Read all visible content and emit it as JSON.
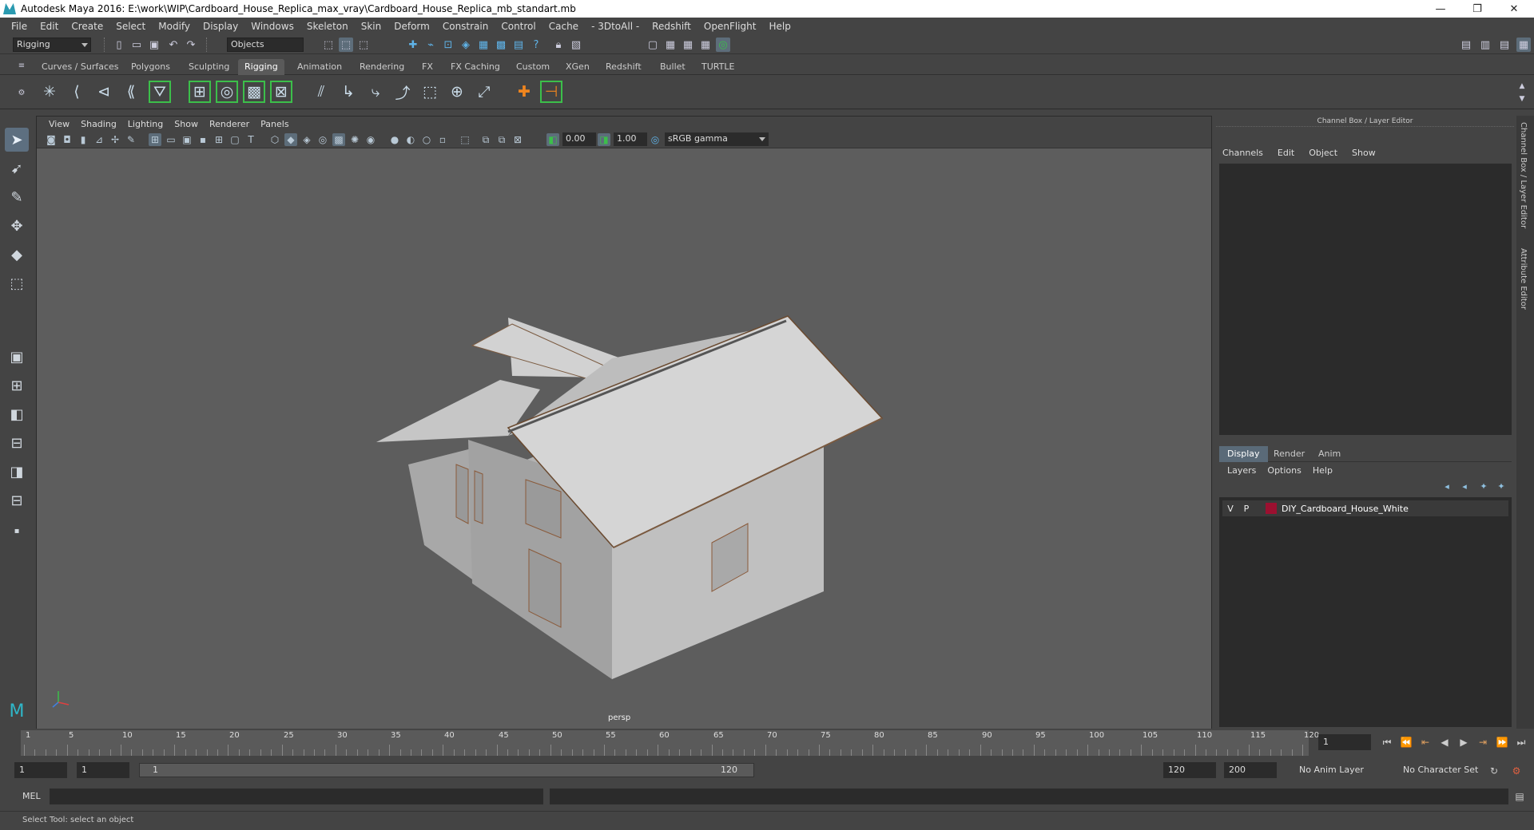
{
  "window": {
    "title": "Autodesk Maya 2016: E:\\work\\WIP\\Cardboard_House_Replica_max_vray\\Cardboard_House_Replica_mb_standart.mb",
    "minimize": "—",
    "restore": "❐",
    "close": "✕"
  },
  "menu": [
    "File",
    "Edit",
    "Create",
    "Select",
    "Modify",
    "Display",
    "Windows",
    "Skeleton",
    "Skin",
    "Deform",
    "Constrain",
    "Control",
    "Cache",
    "- 3DtoAll -",
    "Redshift",
    "OpenFlight",
    "Help"
  ],
  "status": {
    "mode": "Rigging",
    "objects": "Objects"
  },
  "shelf_tabs": [
    "Curves / Surfaces",
    "Polygons",
    "Sculpting",
    "Rigging",
    "Animation",
    "Rendering",
    "FX",
    "FX Caching",
    "Custom",
    "XGen",
    "Redshift",
    "Bullet",
    "TURTLE"
  ],
  "viewport": {
    "menu": [
      "View",
      "Shading",
      "Lighting",
      "Show",
      "Renderer",
      "Panels"
    ],
    "exposure": "0.00",
    "gamma": "1.00",
    "color_space": "sRGB gamma",
    "camera": "persp"
  },
  "channel_box": {
    "title": "Channel Box / Layer Editor",
    "menu": [
      "Channels",
      "Edit",
      "Object",
      "Show"
    ]
  },
  "layer_editor": {
    "tabs": [
      "Display",
      "Render",
      "Anim"
    ],
    "menu": [
      "Layers",
      "Options",
      "Help"
    ],
    "layer": {
      "v": "V",
      "p": "P",
      "name": "DIY_Cardboard_House_White",
      "color": "#9b1030"
    }
  },
  "side_tabs": [
    "Channel Box / Layer Editor",
    "Attribute Editor"
  ],
  "timeline": {
    "labels": [
      "1",
      "5",
      "10",
      "15",
      "20",
      "25",
      "30",
      "35",
      "40",
      "45",
      "50",
      "55",
      "60",
      "65",
      "70",
      "75",
      "80",
      "85",
      "90",
      "95",
      "100",
      "105",
      "110",
      "115",
      "120"
    ],
    "current_frame": "1"
  },
  "range": {
    "start": "1",
    "start_inner": "1",
    "slider_start": "1",
    "slider_end": "120",
    "end": "120",
    "end_outer": "200",
    "anim_layer": "No Anim Layer",
    "char_set": "No Character Set"
  },
  "command": {
    "label": "MEL"
  },
  "help": {
    "text": "Select Tool: select an object"
  }
}
